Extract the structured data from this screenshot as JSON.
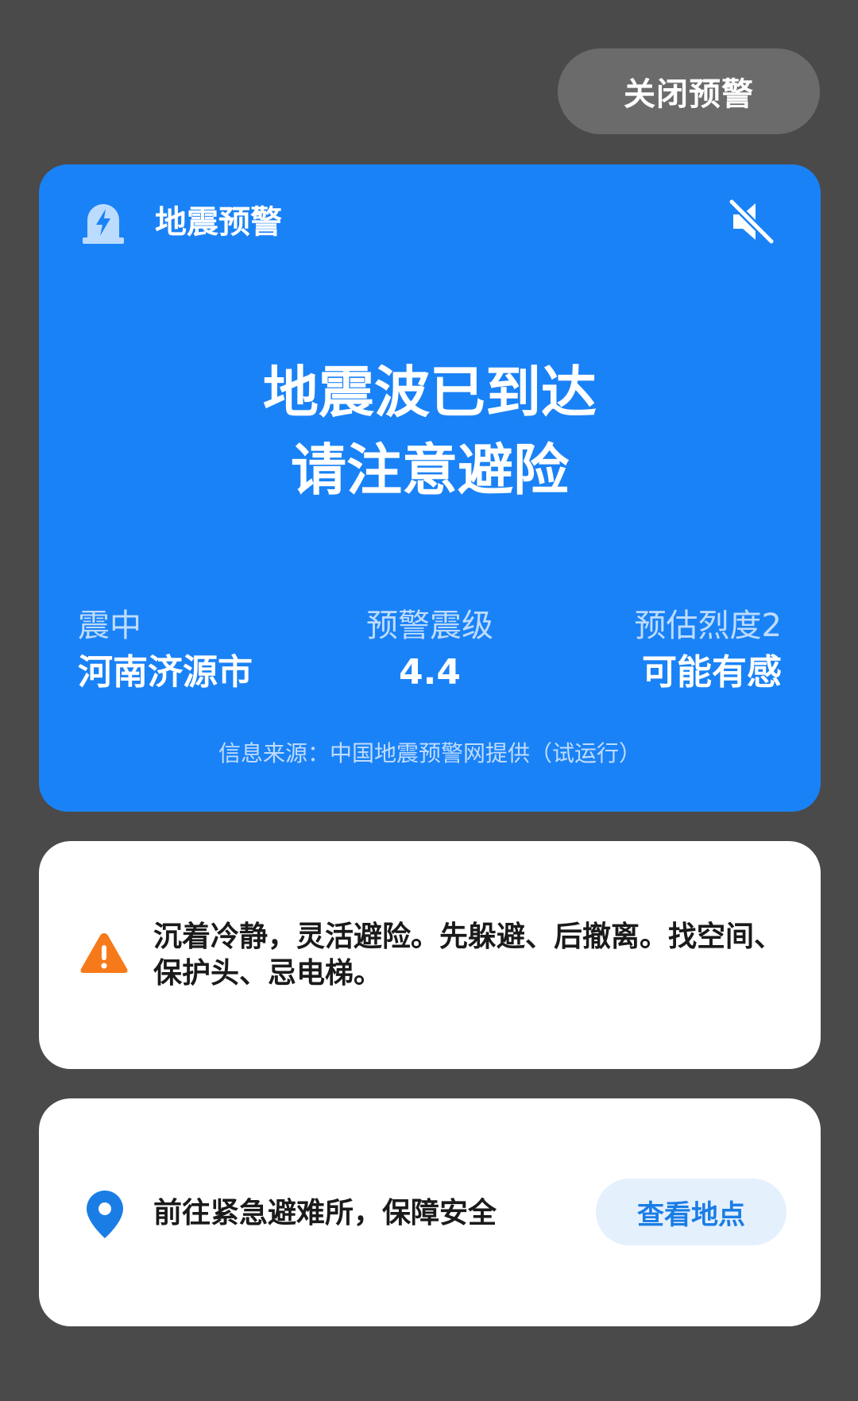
{
  "close_button": {
    "label": "关闭预警"
  },
  "alert": {
    "title": "地震预警",
    "headline_line1": "地震波已到达",
    "headline_line2": "请注意避险",
    "epicenter_label": "震中",
    "epicenter_value": "河南济源市",
    "magnitude_label": "预警震级",
    "magnitude_value": "4.4",
    "intensity_label": "预估烈度2",
    "intensity_value": "可能有感",
    "source": "信息来源：中国地震预警网提供（试运行）",
    "header_icon": "alarm-light-icon",
    "mute_icon": "speaker-muted-icon",
    "background_color": "#1a82f7"
  },
  "safety_tip": {
    "icon": "warning-triangle-icon",
    "icon_color": "#f77a1a",
    "text": "沉着冷静，灵活避险。先躲避、后撤离。找空间、保护头、忌电梯。"
  },
  "shelter": {
    "icon": "location-pin-icon",
    "icon_color": "#1a7de6",
    "text": "前往紧急避难所，保障安全",
    "button_label": "查看地点"
  }
}
